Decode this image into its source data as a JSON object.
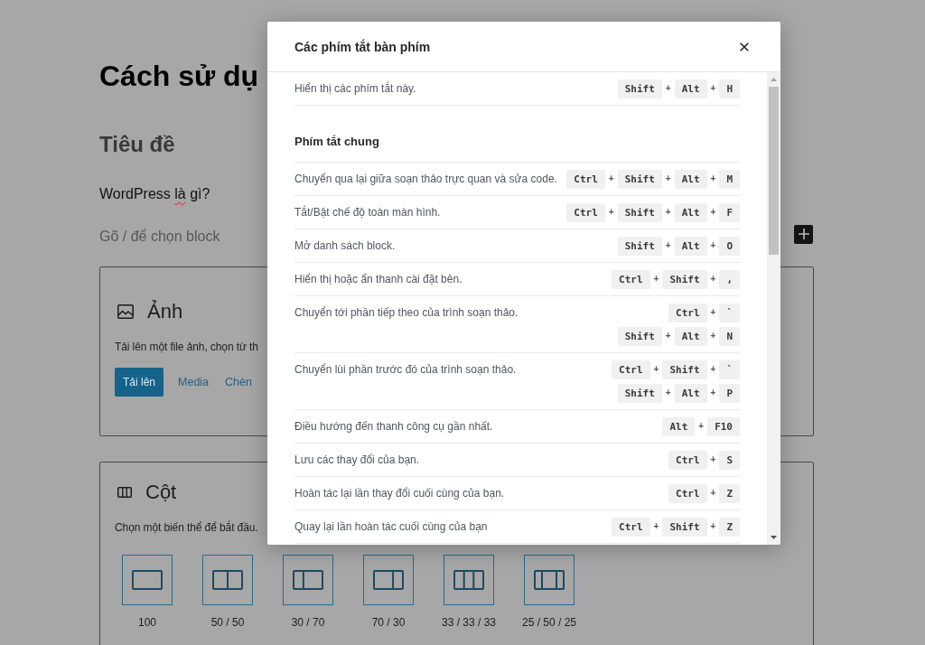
{
  "page": {
    "title": "Cách sử dụ",
    "heading": "Tiêu đề",
    "paragraph": {
      "parts": [
        {
          "text": "WordPress ",
          "misspelled": false
        },
        {
          "text": "là",
          "misspelled": true
        },
        {
          "text": " gì?",
          "misspelled": false
        }
      ]
    },
    "placeholder": "Gõ / để chọn block"
  },
  "image_block": {
    "title": "Ảnh",
    "instructions": "Tải lên một file ảnh, chọn từ th",
    "actions": [
      {
        "label": "Tải lên",
        "kind": "primary"
      },
      {
        "label": "Media",
        "kind": "link"
      },
      {
        "label": "Chèn",
        "kind": "link"
      }
    ]
  },
  "columns_block": {
    "title": "Cột",
    "instructions": "Chọn một biến thể để bắt đầu.",
    "variations": [
      {
        "label": "100"
      },
      {
        "label": "50 / 50"
      },
      {
        "label": "30 / 70"
      },
      {
        "label": "70 / 30"
      },
      {
        "label": "33 / 33 / 33"
      },
      {
        "label": "25 / 50 / 25"
      }
    ]
  },
  "dialog": {
    "title": "Các phím tắt bàn phím",
    "sections": [
      {
        "shortcuts": [
          {
            "description": "Hiển thị các phím tắt này.",
            "combinations": [
              [
                "Shift",
                "+",
                "Alt",
                "+",
                "H"
              ]
            ]
          }
        ]
      },
      {
        "heading": "Phím tắt chung",
        "shortcuts": [
          {
            "description": "Chuyển qua lại giữa soạn thảo trực quan và sửa code.",
            "combinations": [
              [
                "Ctrl",
                "+",
                "Shift",
                "+",
                "Alt",
                "+",
                "M"
              ]
            ]
          },
          {
            "description": "Tắt/Bật chế độ toàn màn hình.",
            "combinations": [
              [
                "Ctrl",
                "+",
                "Shift",
                "+",
                "Alt",
                "+",
                "F"
              ]
            ]
          },
          {
            "description": "Mở danh sách block.",
            "combinations": [
              [
                "Shift",
                "+",
                "Alt",
                "+",
                "O"
              ]
            ]
          },
          {
            "description": "Hiển thị hoặc ẩn thanh cài đặt bên.",
            "combinations": [
              [
                "Ctrl",
                "+",
                "Shift",
                "+",
                ","
              ]
            ]
          },
          {
            "description": "Chuyển tới phần tiếp theo của trình soạn thảo.",
            "combinations": [
              [
                "Ctrl",
                "+",
                "`"
              ],
              [
                "Shift",
                "+",
                "Alt",
                "+",
                "N"
              ]
            ]
          },
          {
            "description": "Chuyển lùi phần trước đó của trình soạn thảo.",
            "combinations": [
              [
                "Ctrl",
                "+",
                "Shift",
                "+",
                "`"
              ],
              [
                "Shift",
                "+",
                "Alt",
                "+",
                "P"
              ]
            ]
          },
          {
            "description": "Điều hướng đến thanh công cụ gần nhất.",
            "combinations": [
              [
                "Alt",
                "+",
                "F10"
              ]
            ]
          },
          {
            "description": "Lưu các thay đổi của bạn.",
            "combinations": [
              [
                "Ctrl",
                "+",
                "S"
              ]
            ]
          },
          {
            "description": "Hoàn tác lại lần thay đổi cuối cùng của bạn.",
            "combinations": [
              [
                "Ctrl",
                "+",
                "Z"
              ]
            ]
          },
          {
            "description": "Quay lại lần hoàn tác cuối cùng của bạn",
            "combinations": [
              [
                "Ctrl",
                "+",
                "Shift",
                "+",
                "Z"
              ]
            ]
          }
        ]
      }
    ]
  }
}
